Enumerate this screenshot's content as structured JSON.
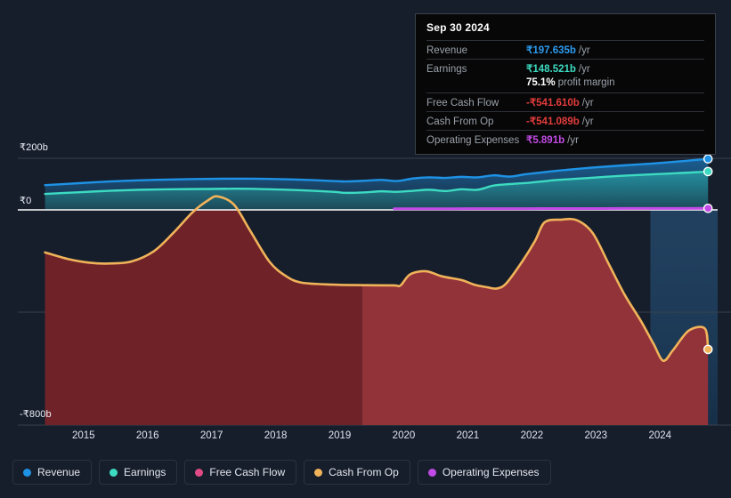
{
  "chart_data": {
    "type": "area",
    "title": "",
    "xlabel": "",
    "ylabel": "",
    "currency": "₹",
    "unit": "b",
    "axis": {
      "y_ticks": [
        "₹200b",
        "₹0",
        "-₹800b"
      ],
      "y_tick_values": [
        200,
        0,
        -800
      ],
      "ylim": [
        -830,
        250
      ],
      "x_ticks": [
        "2015",
        "2016",
        "2017",
        "2018",
        "2019",
        "2020",
        "2021",
        "2022",
        "2023",
        "2024"
      ],
      "x_tick_values": [
        2015,
        2016,
        2017,
        2018,
        2019,
        2020,
        2021,
        2022,
        2023,
        2024
      ],
      "xlim": [
        2014.35,
        2024.9
      ],
      "grid": true,
      "legend_position": "bottom"
    },
    "series": [
      {
        "name": "Revenue",
        "color": "#1e93e6",
        "x": [
          2014.4,
          2014.9,
          2015.4,
          2015.9,
          2016.4,
          2016.9,
          2017.4,
          2017.9,
          2018.4,
          2018.9,
          2019.1,
          2019.4,
          2019.65,
          2019.9,
          2020.15,
          2020.4,
          2020.65,
          2020.9,
          2021.15,
          2021.4,
          2021.65,
          2021.9,
          2022.15,
          2022.4,
          2022.9,
          2023.4,
          2023.9,
          2024.4,
          2024.75
        ],
        "values": [
          96,
          103,
          110,
          115,
          118,
          120,
          121,
          120,
          117,
          112,
          110,
          113,
          116,
          112,
          122,
          126,
          124,
          128,
          126,
          134,
          129,
          138,
          145,
          152,
          163,
          172,
          180,
          190,
          197.635
        ]
      },
      {
        "name": "Earnings",
        "color": "#3ddbc2",
        "x": [
          2014.4,
          2014.9,
          2015.4,
          2015.9,
          2016.4,
          2016.9,
          2017.4,
          2017.9,
          2018.4,
          2018.9,
          2019.1,
          2019.4,
          2019.65,
          2019.9,
          2020.15,
          2020.4,
          2020.65,
          2020.9,
          2021.15,
          2021.4,
          2021.65,
          2021.9,
          2022.15,
          2022.4,
          2022.9,
          2023.4,
          2023.9,
          2024.4,
          2024.75
        ],
        "values": [
          62,
          68,
          74,
          78,
          80,
          81,
          82,
          80,
          76,
          70,
          66,
          68,
          72,
          70,
          74,
          78,
          73,
          80,
          78,
          94,
          100,
          104,
          110,
          116,
          124,
          132,
          138,
          144,
          148.521
        ]
      },
      {
        "name": "Free Cash Flow",
        "color": "#e24a86",
        "x": [],
        "values": []
      },
      {
        "name": "Cash From Op",
        "color": "#f0b35a",
        "x": [
          2014.4,
          2014.75,
          2015.1,
          2015.4,
          2015.75,
          2016.1,
          2016.4,
          2016.7,
          2016.95,
          2017.1,
          2017.35,
          2017.6,
          2017.9,
          2018.15,
          2018.4,
          2018.9,
          2019.4,
          2019.85,
          2019.95,
          2020.1,
          2020.35,
          2020.6,
          2020.9,
          2021.1,
          2021.3,
          2021.45,
          2021.6,
          2021.85,
          2022.05,
          2022.2,
          2022.45,
          2022.7,
          2022.95,
          2023.2,
          2023.45,
          2023.7,
          2023.9,
          2024.05,
          2024.2,
          2024.45,
          2024.7,
          2024.75
        ],
        "values": [
          -165,
          -190,
          -205,
          -208,
          -200,
          -160,
          -90,
          -10,
          38,
          52,
          20,
          -80,
          -200,
          -255,
          -282,
          -290,
          -292,
          -293,
          -293,
          -250,
          -238,
          -258,
          -272,
          -290,
          -300,
          -305,
          -285,
          -200,
          -120,
          -48,
          -38,
          -40,
          -90,
          -210,
          -330,
          -430,
          -520,
          -585,
          -545,
          -468,
          -460,
          -541.089
        ]
      },
      {
        "name": "Operating Expenses",
        "color": "#c24ae6",
        "x": [
          2019.85,
          2020.4,
          2021.0,
          2021.6,
          2022.2,
          2022.8,
          2023.4,
          2024.0,
          2024.75
        ],
        "values": [
          4.2,
          4.4,
          4.6,
          4.8,
          5.0,
          5.2,
          5.4,
          5.7,
          5.891
        ]
      }
    ],
    "regions": [
      {
        "name": "past-dark",
        "from": 2014.35,
        "to": 2019.35
      },
      {
        "name": "past-light",
        "from": 2019.35,
        "to": 2023.85
      },
      {
        "name": "forecast",
        "from": 2023.85,
        "to": 2024.9
      }
    ]
  },
  "tooltip": {
    "date": "Sep 30 2024",
    "rows": [
      {
        "key": "Revenue",
        "value": "₹197.635b",
        "suffix": "/yr",
        "color": "#2d9bf0"
      },
      {
        "key": "Earnings",
        "value": "₹148.521b",
        "suffix": "/yr",
        "color": "#3ddbc2"
      },
      {
        "key": "",
        "value": "75.1%",
        "suffix": "profit margin",
        "color": "#ffffff",
        "sub": true
      },
      {
        "key": "Free Cash Flow",
        "value": "-₹541.610b",
        "suffix": "/yr",
        "color": "#e33c3c"
      },
      {
        "key": "Cash From Op",
        "value": "-₹541.089b",
        "suffix": "/yr",
        "color": "#e33c3c"
      },
      {
        "key": "Operating Expenses",
        "value": "₹5.891b",
        "suffix": "/yr",
        "color": "#c24ae6"
      }
    ]
  },
  "legend": {
    "items": [
      {
        "label": "Revenue",
        "color": "#1e93e6"
      },
      {
        "label": "Earnings",
        "color": "#3ddbc2"
      },
      {
        "label": "Free Cash Flow",
        "color": "#e24a86"
      },
      {
        "label": "Cash From Op",
        "color": "#f0b35a"
      },
      {
        "label": "Operating Expenses",
        "color": "#c24ae6"
      }
    ]
  },
  "colors": {
    "background": "#171e2b",
    "zero_line": "#ffffff",
    "gridline": "#39404e",
    "negative_fill": "#7e2a30",
    "forecast_tint": "#1d3550"
  }
}
